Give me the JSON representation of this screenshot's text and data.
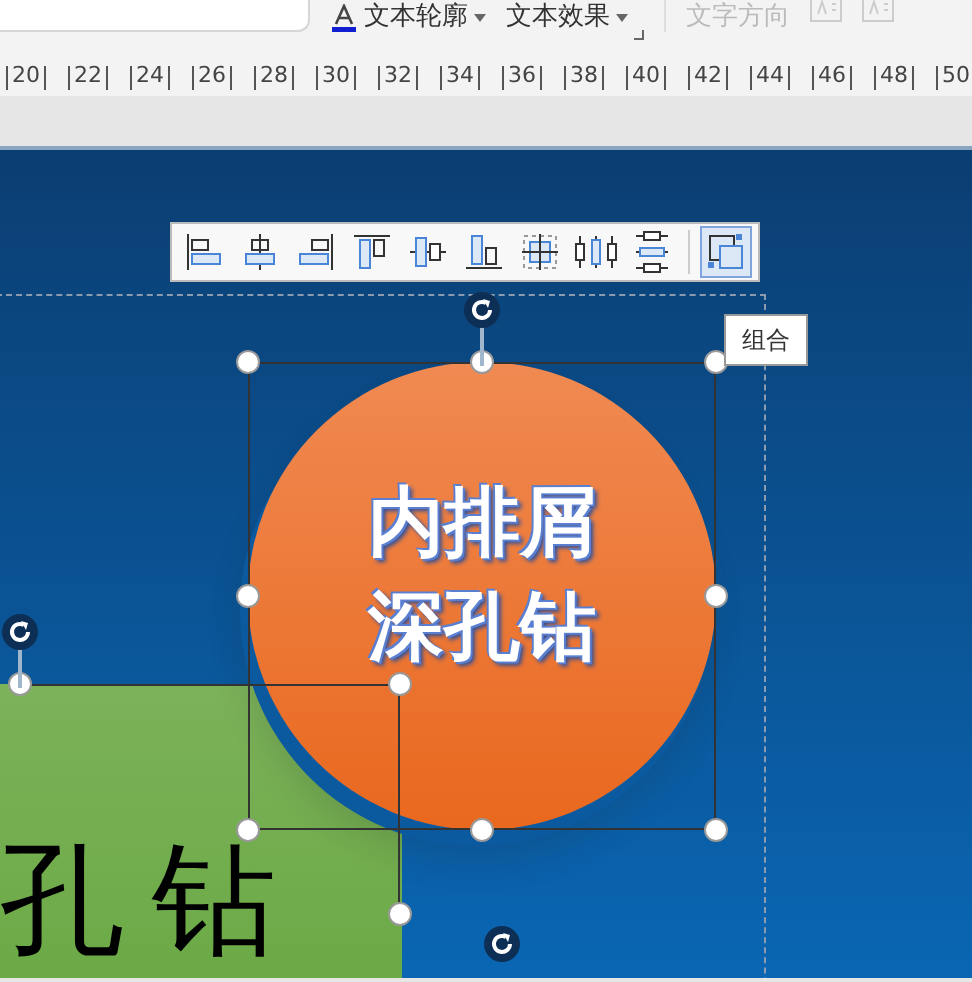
{
  "ribbon": {
    "items": [
      {
        "label": "文本轮廓",
        "kind": "outline",
        "disabled": false
      },
      {
        "label": "文本效果",
        "kind": "effect",
        "disabled": false
      },
      {
        "label": "文字方向",
        "kind": "direction",
        "disabled": true
      }
    ]
  },
  "ruler": {
    "ticks": [
      "20",
      "22",
      "24",
      "26",
      "28",
      "30",
      "32",
      "34",
      "36",
      "38",
      "40",
      "42",
      "44",
      "46",
      "48",
      "50"
    ]
  },
  "align_toolbar": {
    "buttons": [
      {
        "kind": "align-left",
        "selected": false
      },
      {
        "kind": "align-center",
        "selected": false
      },
      {
        "kind": "align-right",
        "selected": false
      },
      {
        "kind": "align-top",
        "selected": false
      },
      {
        "kind": "align-middle",
        "selected": false
      },
      {
        "kind": "align-bottom",
        "selected": false
      },
      {
        "kind": "center",
        "selected": false
      },
      {
        "kind": "distribute-h",
        "selected": false
      },
      {
        "kind": "distribute-v",
        "selected": false
      },
      {
        "kind": "group",
        "selected": true
      }
    ]
  },
  "tooltip": "组合",
  "slide": {
    "circle": {
      "lines": [
        "内排屑",
        "深孔钻"
      ]
    },
    "green_box": {
      "text": "孔钻"
    }
  }
}
